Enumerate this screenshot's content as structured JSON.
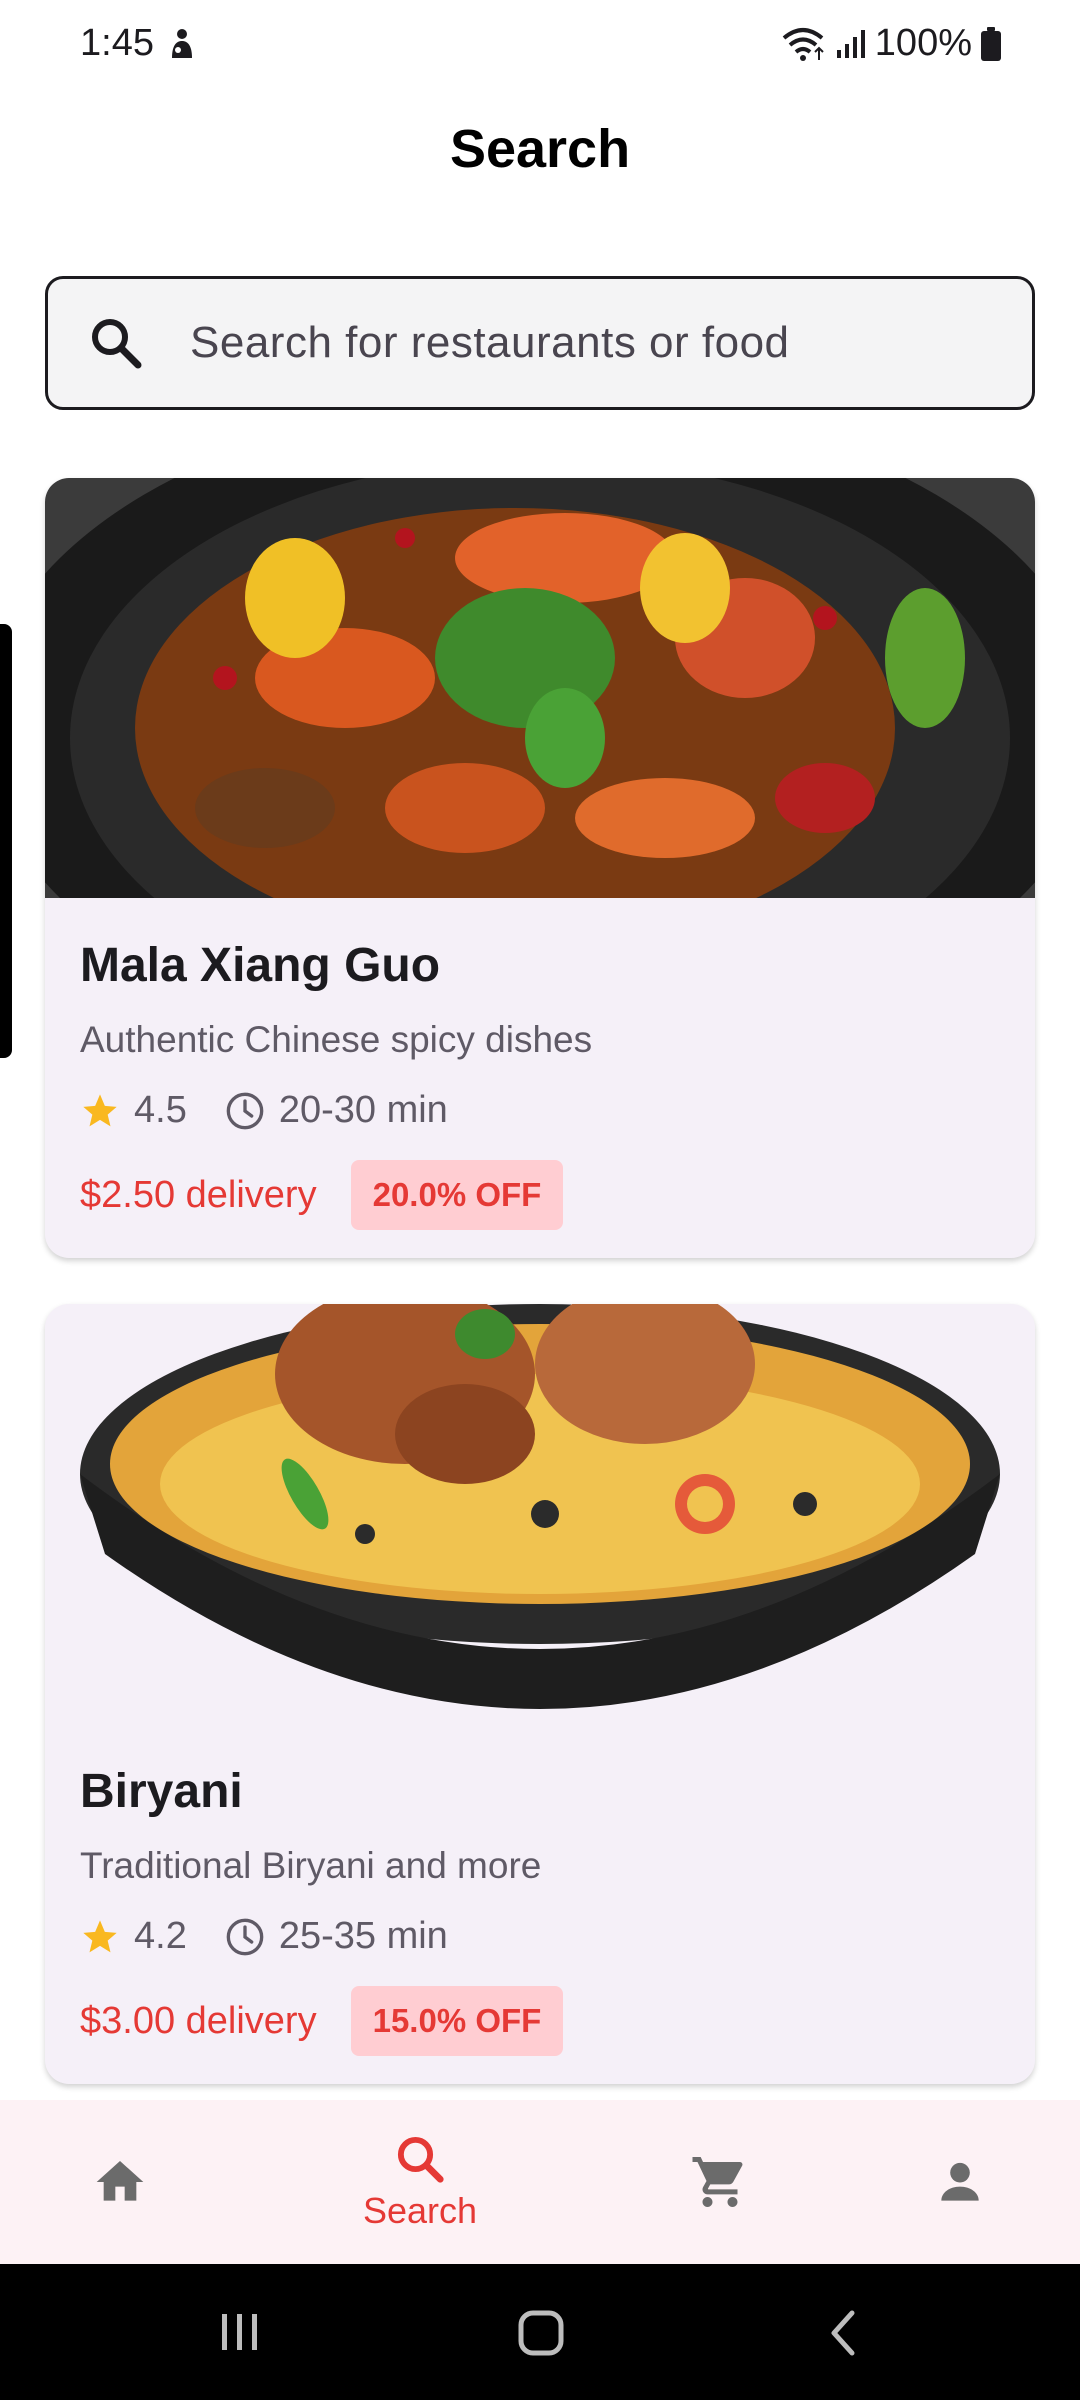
{
  "status_bar": {
    "time": "1:45",
    "battery": "100%"
  },
  "page_title": "Search",
  "search": {
    "placeholder": "Search for restaurants or food",
    "icon": "search-icon"
  },
  "restaurants": [
    {
      "name": "Mala Xiang Guo",
      "description": "Authentic Chinese spicy dishes",
      "rating": "4.5",
      "time": "20-30 min",
      "delivery": "$2.50 delivery",
      "discount": "20.0% OFF"
    },
    {
      "name": "Biryani",
      "description": "Traditional Biryani and more",
      "rating": "4.2",
      "time": "25-35 min",
      "delivery": "$3.00 delivery",
      "discount": "15.0% OFF"
    }
  ],
  "bottom_nav": {
    "items": [
      {
        "icon": "home-icon",
        "label": ""
      },
      {
        "icon": "search-icon",
        "label": "Search"
      },
      {
        "icon": "cart-icon",
        "label": ""
      },
      {
        "icon": "person-icon",
        "label": ""
      }
    ],
    "active_color": "#e53935",
    "inactive_color": "#6b6b6b"
  },
  "colors": {
    "accent": "#e53935",
    "star": "#f9b820",
    "card_bg": "#f5f0f8",
    "discount_bg": "#ffcdd2"
  }
}
